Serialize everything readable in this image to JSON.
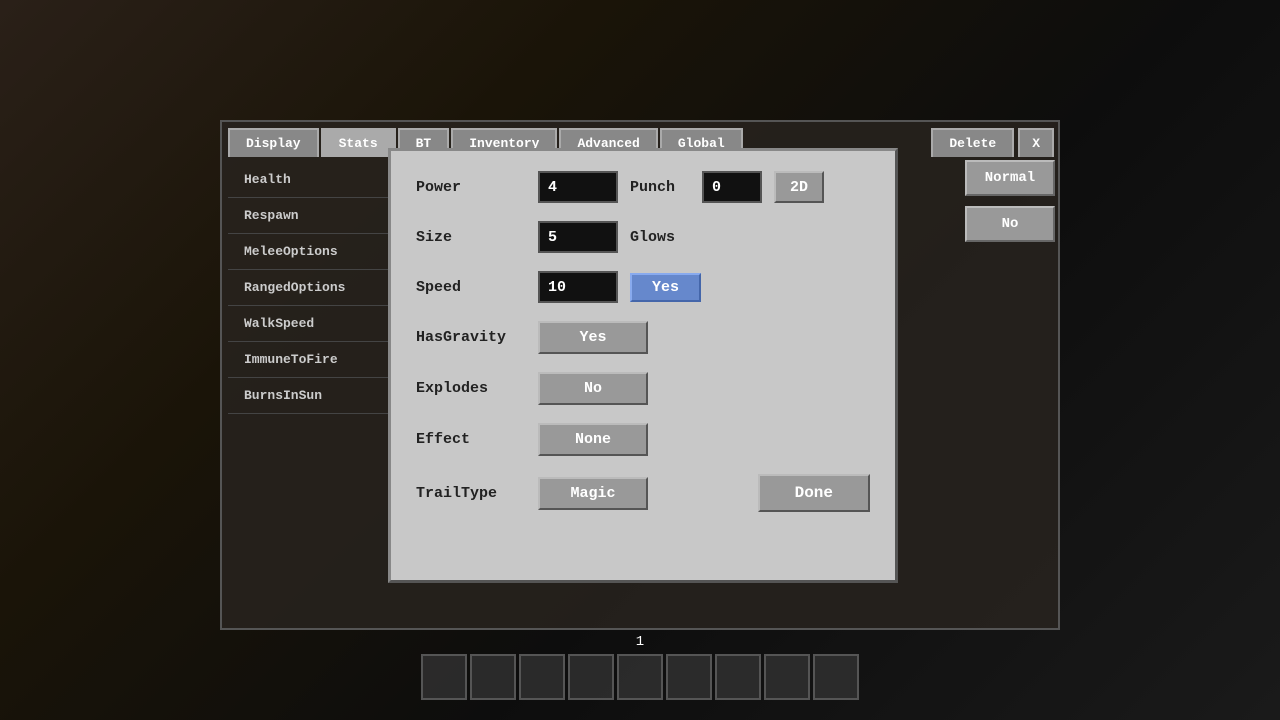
{
  "background": {
    "color": "#1a1408"
  },
  "tabs": {
    "items": [
      {
        "label": "Display",
        "active": false
      },
      {
        "label": "Stats",
        "active": true
      },
      {
        "label": "BT",
        "active": false
      },
      {
        "label": "Inventory",
        "active": false
      },
      {
        "label": "Advanced",
        "active": false
      },
      {
        "label": "Global",
        "active": false
      }
    ],
    "delete_label": "Delete",
    "close_label": "X"
  },
  "sidebar": {
    "items": [
      {
        "label": "Health"
      },
      {
        "label": "Respawn"
      },
      {
        "label": "MeleeOptions"
      },
      {
        "label": "RangedOptions"
      },
      {
        "label": "WalkSpeed"
      },
      {
        "label": "ImmuneToFire"
      },
      {
        "label": "BurnsInSun"
      }
    ]
  },
  "right_panel": {
    "buttons": [
      {
        "label": "Normal"
      },
      {
        "label": "No"
      }
    ]
  },
  "dialog": {
    "rows": [
      {
        "label": "Power",
        "input_value": "4",
        "extra_label": "Punch",
        "extra_input": "0",
        "btn_label": "2D"
      },
      {
        "label": "Size",
        "input_value": "5",
        "extra_label": "Glows",
        "extra_input": null,
        "btn_label": null
      },
      {
        "label": "Speed",
        "input_value": "10",
        "extra_label": null,
        "toggle_label": "Yes",
        "toggle_active": true
      },
      {
        "label": "HasGravity",
        "input_value": null,
        "toggle_label": "Yes",
        "toggle_active": false
      },
      {
        "label": "Explodes",
        "input_value": null,
        "toggle_label": "No",
        "toggle_active": false
      },
      {
        "label": "Effect",
        "input_value": null,
        "toggle_label": "None",
        "toggle_active": false
      },
      {
        "label": "TrailType",
        "input_value": null,
        "toggle_label": "Magic",
        "toggle_active": false,
        "done_label": "Done"
      }
    ]
  },
  "hotbar": {
    "number": "1",
    "slots": 9
  }
}
